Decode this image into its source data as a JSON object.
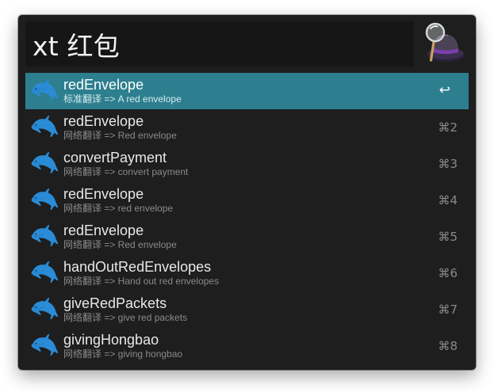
{
  "search": {
    "query": "xt 红包"
  },
  "app_icon": "alfred-hat-magnifier-icon",
  "colors": {
    "window_bg": "#1e1e1e",
    "selected_bg": "#2d7f8f",
    "icon_blue": "#2a8bd6"
  },
  "results": [
    {
      "title": "redEnvelope",
      "subtitle": "标准翻译 => A red envelope",
      "shortcut": "↩",
      "selected": true
    },
    {
      "title": "redEnvelope",
      "subtitle": "网络翻译 => Red envelope",
      "shortcut": "⌘2"
    },
    {
      "title": "convertPayment",
      "subtitle": "网络翻译 => convert payment",
      "shortcut": "⌘3"
    },
    {
      "title": "redEnvelope",
      "subtitle": "网络翻译 => red envelope",
      "shortcut": "⌘4"
    },
    {
      "title": "redEnvelope",
      "subtitle": "网络翻译 => Red envelope",
      "shortcut": "⌘5"
    },
    {
      "title": "handOutRedEnvelopes",
      "subtitle": "网络翻译 => Hand out red envelopes",
      "shortcut": "⌘6"
    },
    {
      "title": "giveRedPackets",
      "subtitle": "网络翻译 => give red packets",
      "shortcut": "⌘7"
    },
    {
      "title": "givingHongbao",
      "subtitle": "网络翻译 => giving hongbao",
      "shortcut": "⌘8"
    }
  ]
}
